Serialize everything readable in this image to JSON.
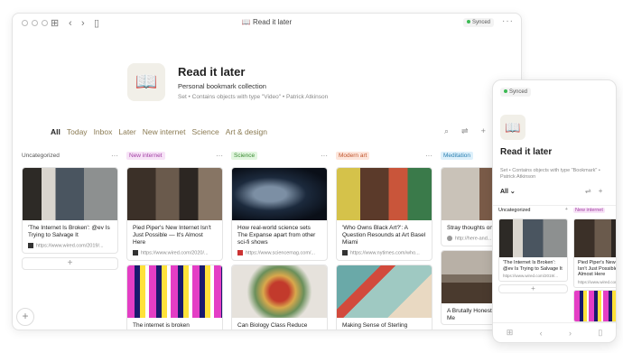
{
  "window": {
    "title": "Read it later",
    "title_icon": "open-book-emoji",
    "synced": "Synced"
  },
  "hero": {
    "title": "Read it later",
    "subtitle": "Personal bookmark collection",
    "meta": "Set  •  Contains objects with type \"Video\"  •  Patrick Atkinson"
  },
  "tabs": [
    "All",
    "Today",
    "Inbox",
    "Later",
    "New internet",
    "Science",
    "Art & design"
  ],
  "columns": [
    {
      "label": "Uncategorized",
      "tag_bg": "",
      "tag_fg": "#555",
      "cards": [
        {
          "title": "'The Internet Is Broken': @ev Is Trying to Salvage It",
          "url": "https://www.wired.com/2019/..."
        }
      ]
    },
    {
      "label": "New internet",
      "tag_bg": "#f7e3f7",
      "tag_fg": "#a23fa3",
      "cards": [
        {
          "title": "Pied Piper's New Internet Isn't Just Possible — It's Almost Here",
          "url": "https://www.wired.com/2020/..."
        },
        {
          "title": "The internet is broken",
          "url": ""
        }
      ]
    },
    {
      "label": "Science",
      "tag_bg": "#e2f6df",
      "tag_fg": "#3a8a33",
      "cards": [
        {
          "title": "How real-world science sets The Expanse apart from other sci-fi shows",
          "url": "https://www.sciencemag.com/..."
        },
        {
          "title": "Can Biology Class Reduce",
          "url": ""
        }
      ]
    },
    {
      "label": "Modern art",
      "tag_bg": "#fde6dc",
      "tag_fg": "#c0552d",
      "cards": [
        {
          "title": "'Who Owns Black Art?': A Question Resounds at Art Basel Miami",
          "url": "https://www.nytimes.com/who..."
        },
        {
          "title": "Making Sense of Sterling",
          "url": ""
        }
      ]
    },
    {
      "label": "Meditation",
      "tag_bg": "#ddf0fb",
      "tag_fg": "#2a7fb0",
      "cards": [
        {
          "title": "Stray thoughts on meditation",
          "url": "http://here-and..."
        },
        {
          "title": "A Brutally Honest 10-Day Silent Me",
          "url": ""
        }
      ]
    }
  ],
  "mobile": {
    "synced": "Synced",
    "title": "Read it later",
    "meta": "Set • Contains objects with type \"Bookmark\" • Patrick Atkinson",
    "filter": "All",
    "columns": [
      {
        "label": "Uncategorized",
        "card": {
          "title": "'The Internet Is Broken': @ev Is Trying to Salvage It",
          "url": "https://www.wired.com/2019/..."
        }
      },
      {
        "label": "New internet",
        "card": {
          "title": "Pied Piper's New Internet Isn't Just Possible — It's Almost Here",
          "url": "https://www.wired.com/..."
        }
      }
    ]
  },
  "colors": {
    "accent_tab": "#8a7a52",
    "synced_dot": "#3cba54"
  }
}
